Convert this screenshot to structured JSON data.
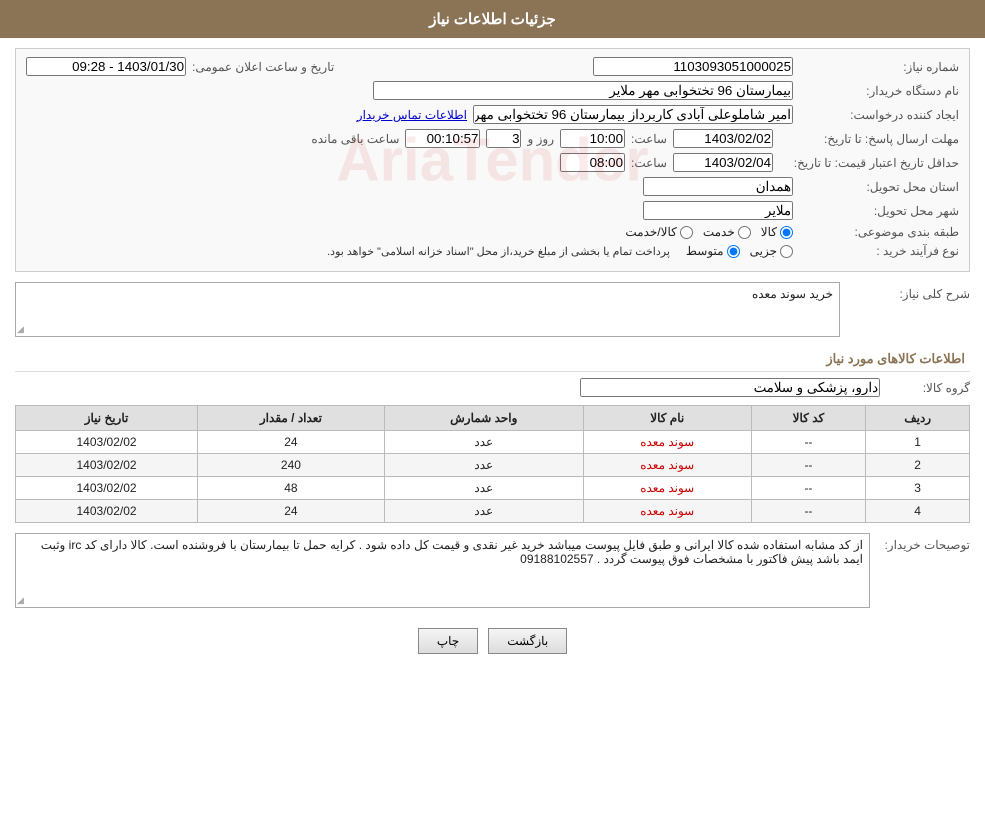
{
  "header": {
    "title": "جزئیات اطلاعات نیاز"
  },
  "fields": {
    "shomareNiaz_label": "شماره نیاز:",
    "shomareNiaz_value": "1103093051000025",
    "namDastgah_label": "نام دستگاه خریدار:",
    "namDastgah_value": "بیمارستان 96 تختخوابی مهر ملایر",
    "ijadKonande_label": "ایجاد کننده درخواست:",
    "ijadKonande_value": "امیر شاملوعلی آبادی کاربرداز بیمارستان 96 تختخوابی مهر ملایر",
    "ijadKonande_link": "اطلاعات تماس خریدار",
    "mohlat_label": "مهلت ارسال پاسخ: تا تاریخ:",
    "mohlat_date": "1403/02/02",
    "mohlat_time_label": "ساعت:",
    "mohlat_time": "10:00",
    "mohlat_roz_label": "روز و",
    "mohlat_roz": "3",
    "mohlat_remaining_label": "ساعت باقی مانده",
    "mohlat_remaining": "00:10:57",
    "hadaq_label": "حداقل تاریخ اعتبار قیمت: تا تاریخ:",
    "hadaq_date": "1403/02/04",
    "hadaq_time_label": "ساعت:",
    "hadaq_time": "08:00",
    "ostan_label": "استان محل تحویل:",
    "ostan_value": "همدان",
    "shahr_label": "شهر محل تحویل:",
    "shahr_value": "ملایر",
    "tabaqe_label": "طبقه بندی موضوعی:",
    "tabaqe_kala": "کالا",
    "tabaqe_khadamat": "خدمت",
    "tabaqe_kala_khadamat": "کالا/خدمت",
    "tabaqe_selected": "kala",
    "noFarayand_label": "نوع فرآیند خرید :",
    "noFarayand_jazri": "جزیی",
    "noFarayand_motevaset": "متوسط",
    "noFarayand_selected": "motevaset",
    "tarikheElan_label": "تاریخ و ساعت اعلان عمومی:",
    "tarikheElan_value": "1403/01/30 - 09:28",
    "noFarayand_description": "پرداخت تمام یا بخشی از مبلغ خرید،از محل \"اسناد خزانه اسلامی\" خواهد بود.",
    "sharh_label": "شرح کلی نیاز:",
    "sharh_value": "خرید سوند معده",
    "goodsInfo_label": "اطلاعات کالاهای مورد نیاز",
    "groupKala_label": "گروه کالا:",
    "groupKala_value": "دارو، پزشکی و سلامت",
    "table_headers": [
      "ردیف",
      "کد کالا",
      "نام کالا",
      "واحد شمارش",
      "تعداد / مقدار",
      "تاریخ نیاز"
    ],
    "table_rows": [
      {
        "radif": "1",
        "kod": "--",
        "name": "سوند معده",
        "vahed": "عدد",
        "tedad": "24",
        "tarikh": "1403/02/02"
      },
      {
        "radif": "2",
        "kod": "--",
        "name": "سوند معده",
        "vahed": "عدد",
        "tedad": "240",
        "tarikh": "1403/02/02"
      },
      {
        "radif": "3",
        "kod": "--",
        "name": "سوند معده",
        "vahed": "عدد",
        "tedad": "48",
        "tarikh": "1403/02/02"
      },
      {
        "radif": "4",
        "kod": "--",
        "name": "سوند معده",
        "vahed": "عدد",
        "tedad": "24",
        "tarikh": "1403/02/02"
      }
    ],
    "tosaif_label": "توصیحات خریدار:",
    "tosaif_value": "از کد مشابه استفاده شده کالا ایرانی و طبق فایل پیوست میباشد  خرید غیر نقدی و قیمت کل داده شود . کرایه حمل تا بیمارستان با فروشنده است. کالا دارای کد irc  وثبت ایمد باشد پیش فاکتور با مشخصات فوق پیوست گردد . 09188102557",
    "btn_print": "چاپ",
    "btn_back": "بازگشت"
  }
}
